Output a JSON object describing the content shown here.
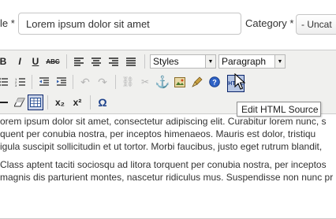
{
  "form": {
    "title_label": "le *",
    "title_value": "Lorem ipsum dolor sit amet",
    "category_label": "Category *",
    "category_value": "- Uncat"
  },
  "toolbar": {
    "row1": {
      "bold": "B",
      "italic": "I",
      "underline": "U",
      "strike": "ABC",
      "styles_label": "Styles",
      "format_label": "Paragraph"
    },
    "html_button_text": "HTML",
    "subscript": "x₂",
    "superscript": "x²",
    "special_char": "Ω",
    "tooltip": "Edit HTML Source"
  },
  "content": {
    "paragraphs": [
      [
        "orem ipsum dolor sit amet, consectetur adipiscing elit. Curabitur lorem nunc, s",
        "quent per conubia nostra, per inceptos himenaeos. Mauris est dolor, tristiqu",
        "igula suscipit sollicitudin et ut tortor. Morbi faucibus, justo eget rutrum blandit,"
      ],
      [
        "Class aptent taciti sociosqu ad litora torquent per conubia nostra, per inceptos",
        "magnis dis parturient montes, nascetur ridiculus mus. Suspendisse non nunc pr"
      ]
    ]
  },
  "colors": {
    "toolbar_bg": "#f0f0ee",
    "active_button": "#b6c6e4",
    "accent_border": "#0a246a"
  }
}
